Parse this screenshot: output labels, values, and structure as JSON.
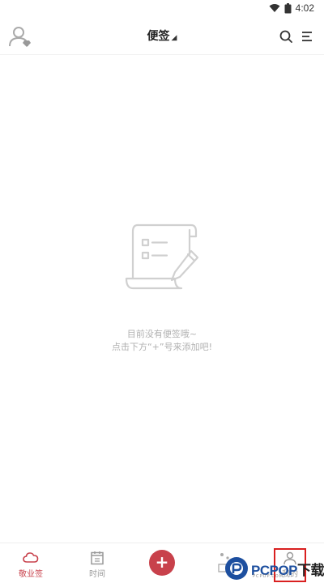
{
  "status_bar": {
    "time": "4:02",
    "wifi_icon": "wifi-icon",
    "battery_icon": "battery-icon"
  },
  "header": {
    "title": "便签",
    "avatar_icon": "avatar-icon",
    "search_icon": "search-icon",
    "menu_icon": "menu-icon"
  },
  "empty_state": {
    "line1": "目前没有便签哦~",
    "line2": "点击下方“+”号来添加吧!",
    "illustration_icon": "note-scroll-icon"
  },
  "tab_bar": {
    "tabs": [
      {
        "label": "敬业签",
        "icon": "cloud-icon",
        "active": true
      },
      {
        "label": "时间",
        "icon": "calendar-icon",
        "active": false
      },
      {
        "label": "我的",
        "icon": "user-icon",
        "active": false
      }
    ],
    "add_label": "+",
    "accent_color": "#c8414b"
  },
  "watermark": {
    "brand": "PCPOP",
    "suffix": "下载",
    "subtext": "PCPOP.COM"
  }
}
